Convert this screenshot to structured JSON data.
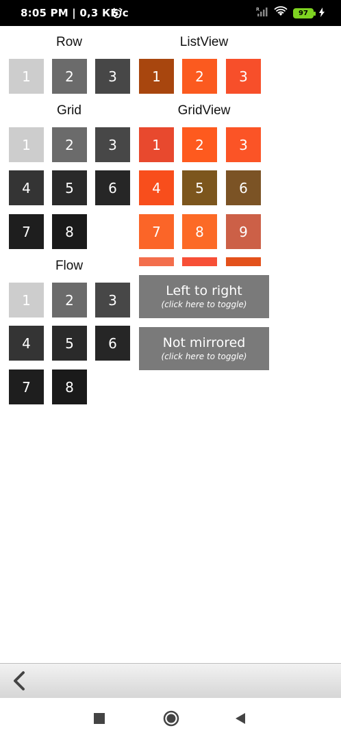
{
  "status": {
    "time": "8:05 PM | 0,3 КБ/с",
    "battery": "97"
  },
  "headers": {
    "row": "Row",
    "listview": "ListView",
    "grid": "Grid",
    "gridview": "GridView",
    "flow": "Flow"
  },
  "row_tiles": [
    "1",
    "2",
    "3"
  ],
  "listview_tiles": [
    "1",
    "2",
    "3"
  ],
  "grid_tiles": [
    "1",
    "2",
    "3",
    "4",
    "5",
    "6",
    "7",
    "8"
  ],
  "gridview_tiles": [
    "1",
    "2",
    "3",
    "4",
    "5",
    "6",
    "7",
    "8",
    "9"
  ],
  "flow_tiles": [
    "1",
    "2",
    "3",
    "4",
    "5",
    "6",
    "7",
    "8"
  ],
  "layout_toggle": {
    "label": "Left to right",
    "hint": "(click here to toggle)"
  },
  "mirror_toggle": {
    "label": "Not mirrored",
    "hint": "(click here to toggle)"
  },
  "colors": {
    "gray": [
      "#cdcdcd",
      "#6b6b6b",
      "#474747",
      "#343434",
      "#2a2a2a",
      "#262626",
      "#1e1e1e",
      "#1a1a1a"
    ],
    "listview": [
      "#a8460e",
      "#fb5a1f",
      "#f74f2a"
    ],
    "gridview": [
      "#e8492e",
      "#fe5a1e",
      "#fb5426",
      "#f84e1c",
      "#7c561d",
      "#7b5325",
      "#fb6528",
      "#fc6a26",
      "#cc6047"
    ],
    "gridview_partial": [
      "#f36e4c",
      "#f74f36",
      "#e3511b"
    ]
  }
}
